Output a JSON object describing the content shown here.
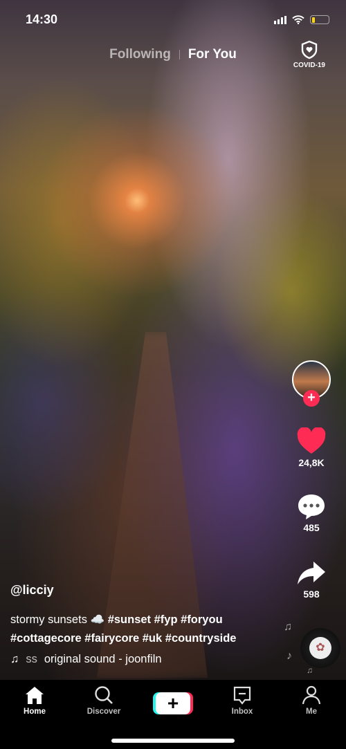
{
  "status": {
    "time": "14:30",
    "battery_level": 0.2
  },
  "topnav": {
    "following": "Following",
    "for_you": "For You",
    "covid": "COVID-19"
  },
  "actions": {
    "likes": "24,8K",
    "comments": "485",
    "shares": "598"
  },
  "video": {
    "username": "@licciy",
    "description_text": "stormy sunsets",
    "description_emoji": "☁️",
    "hashtags_line1": "#sunset #fyp #foryou",
    "hashtags_line2": "#cottagecore #fairycore #uk #countryside",
    "sound_prefix": "ss",
    "sound": "original sound - joonfiln"
  },
  "tabs": {
    "home": "Home",
    "discover": "Discover",
    "create": "+",
    "inbox": "Inbox",
    "me": "Me"
  },
  "colors": {
    "accent": "#fe2c55",
    "cyan": "#25f4ee"
  }
}
